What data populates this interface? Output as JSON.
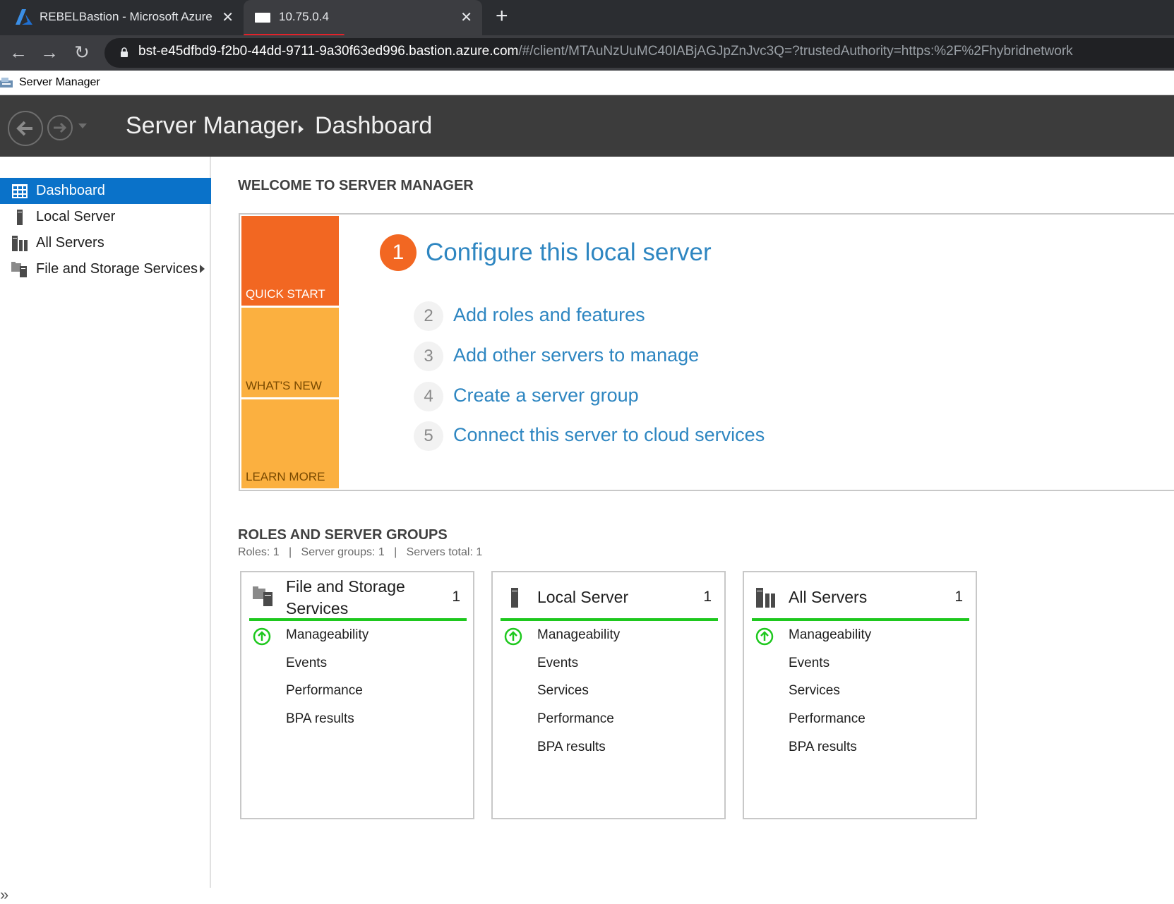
{
  "browser": {
    "tabs": [
      {
        "title": "REBELBastion - Microsoft Azure",
        "close": "✕"
      },
      {
        "title": "10.75.0.4",
        "close": "✕"
      }
    ],
    "new_tab": "+",
    "url_host": "bst-e45dfbd9-f2b0-44dd-9711-9a30f63ed996.bastion.azure.com",
    "url_rest": "/#/client/MTAuNzUuMC40IABjAGJpZnJvc3Q=?trustedAuthority=https:%2F%2Fhybridnetwork",
    "nav": {
      "back": "←",
      "forward": "→",
      "reload": "↻"
    }
  },
  "window": {
    "title": "Server Manager"
  },
  "header": {
    "app": "Server Manager",
    "page": "Dashboard"
  },
  "sidebar": {
    "items": [
      {
        "label": "Dashboard",
        "icon": "dashboard-icon",
        "active": true
      },
      {
        "label": "Local Server",
        "icon": "server-icon"
      },
      {
        "label": "All Servers",
        "icon": "servers-icon"
      },
      {
        "label": "File and Storage Services",
        "icon": "file-storage-icon"
      }
    ],
    "collapse": "»"
  },
  "welcome": {
    "heading": "WELCOME TO SERVER MANAGER",
    "tiles": [
      "QUICK START",
      "WHAT'S NEW",
      "LEARN MORE"
    ],
    "steps": [
      {
        "num": "1",
        "label": "Configure this local server"
      },
      {
        "num": "2",
        "label": "Add roles and features"
      },
      {
        "num": "3",
        "label": "Add other servers to manage"
      },
      {
        "num": "4",
        "label": "Create a server group"
      },
      {
        "num": "5",
        "label": "Connect this server to cloud services"
      }
    ]
  },
  "roles": {
    "heading": "ROLES AND SERVER GROUPS",
    "summary": "Roles: 1   |   Server groups: 1   |   Servers total: 1",
    "cards": [
      {
        "title_line1": "File and Storage",
        "title_line2": "Services",
        "count": "1",
        "rows": [
          "Manageability",
          "Events",
          "Performance",
          "BPA results"
        ]
      },
      {
        "title_line1": "Local Server",
        "count": "1",
        "rows": [
          "Manageability",
          "Events",
          "Services",
          "Performance",
          "BPA results"
        ]
      },
      {
        "title_line1": "All Servers",
        "count": "1",
        "rows": [
          "Manageability",
          "Events",
          "Services",
          "Performance",
          "BPA results"
        ]
      }
    ]
  },
  "colors": {
    "accent_blue": "#0a72c9",
    "link_blue": "#2e86c1",
    "quick_start_orange": "#f26722",
    "tile_yellow": "#fbb040",
    "status_green": "#1ec81e"
  }
}
